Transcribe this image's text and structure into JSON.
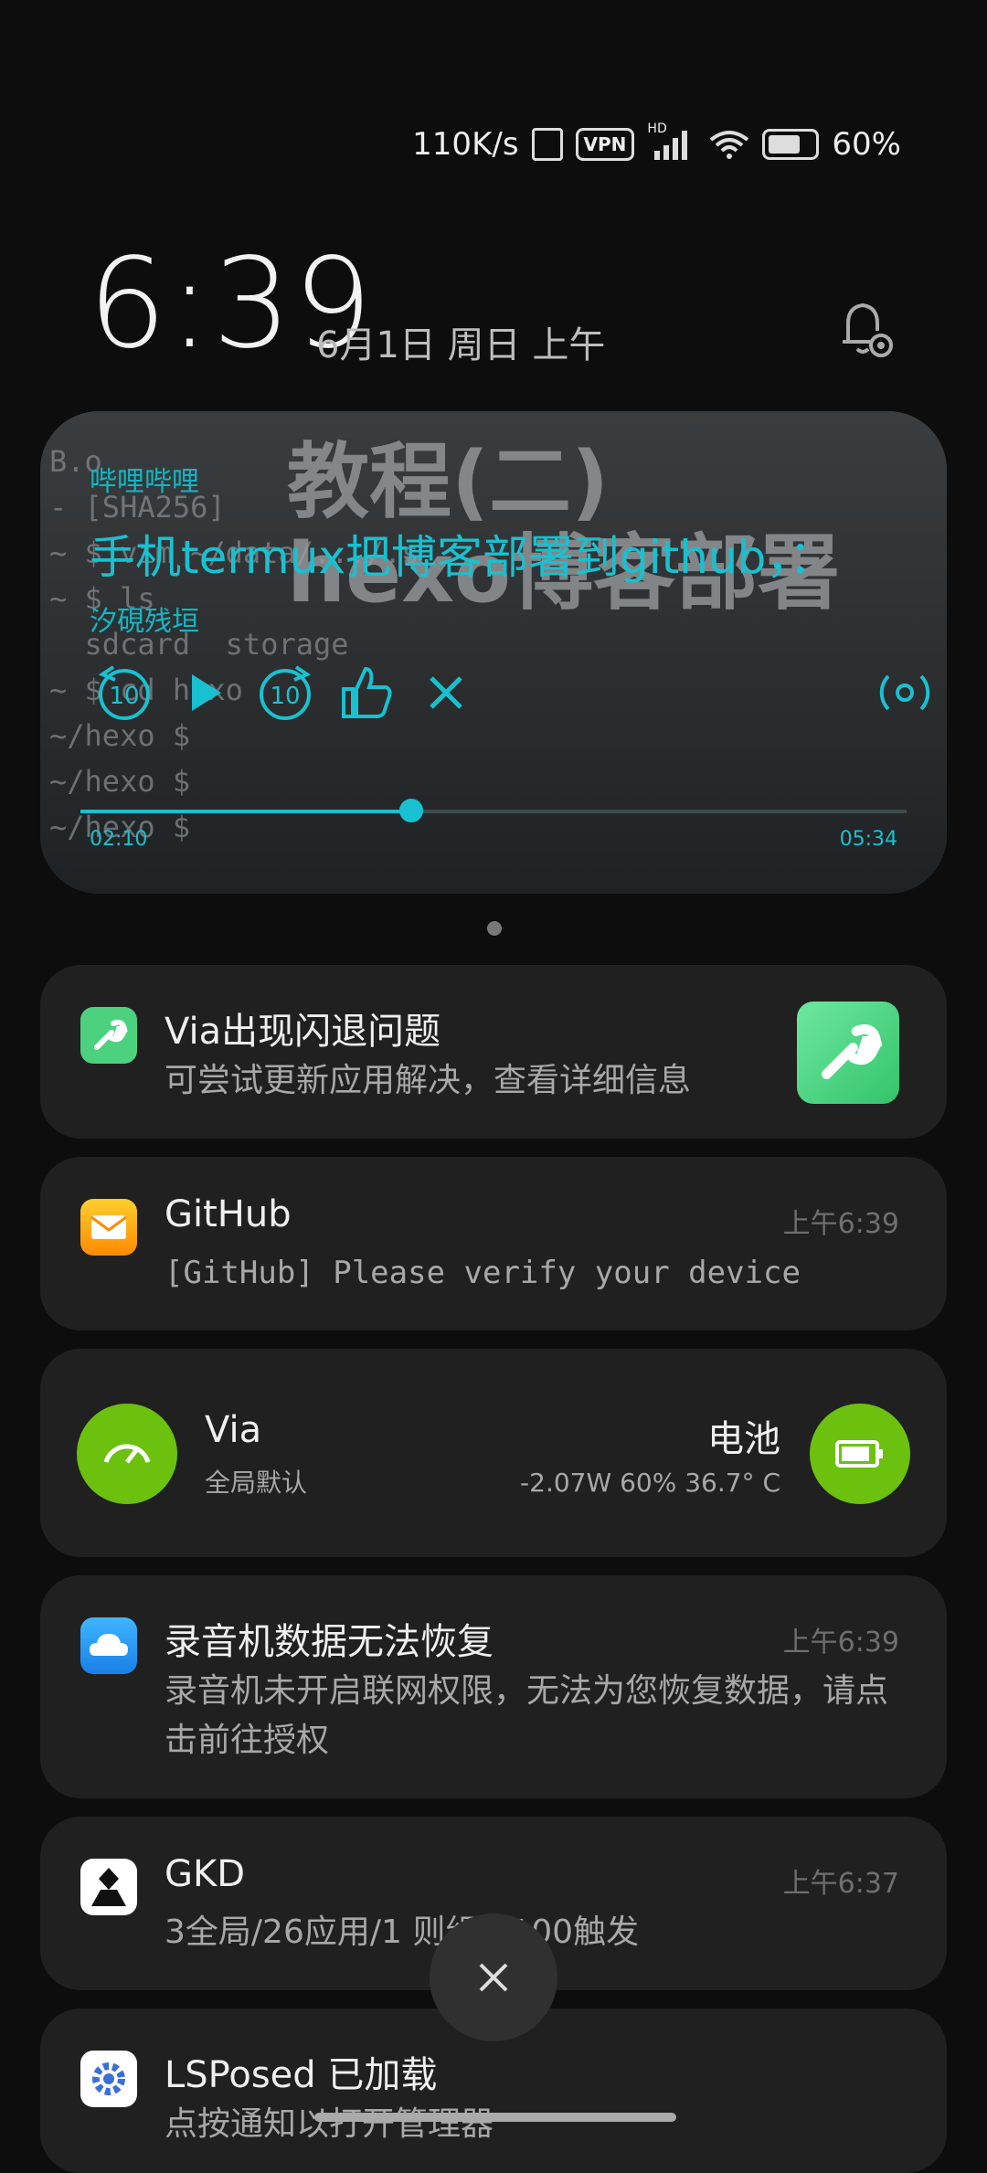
{
  "status_bar": {
    "speed": "110K/s",
    "vpn": "VPN",
    "hd": "HD",
    "battery": "60%",
    "icons": [
      "nfc-icon",
      "vpn-icon",
      "signal-icon",
      "wifi-icon",
      "battery-icon"
    ]
  },
  "lock": {
    "time": "6:39",
    "date": "6月1日 周日 上午"
  },
  "media": {
    "app": "哔哩哔哩",
    "title": "手机termux把博客部署到github，：",
    "artist": "汐硯残垣",
    "bg_big_text": "教程(二)\nhexo博客部署",
    "bg_terminal": "B.o\n- [SHA256]\n~ $ vim ~/data/.../.s\n~ $ ls\n  sdcard  storage\n~ $ cd hexo\n~/hexo $\n~/hexo $\n~/hexo $",
    "elapsed": "02:10",
    "duration": "05:34",
    "progress": 0.4,
    "accent": "#18c1d0"
  },
  "notifications": [
    {
      "title": "Via出现闪退问题",
      "body": "可尝试更新应用解决，查看详细信息",
      "icon": "wrench-icon"
    },
    {
      "title": "GitHub",
      "body": "[GitHub] Please verify your device",
      "time": "上午6:39",
      "icon": "mail-icon"
    },
    {
      "left_title": "Via",
      "left_sub": "全局默认",
      "right_title": "电池",
      "right_sub": "-2.07W 60% 36.7° C"
    },
    {
      "title": "录音机数据无法恢复",
      "body": "录音机未开启联网权限，无法为您恢复数据，请点击前往授权",
      "time": "上午6:39",
      "icon": "cloud-icon"
    },
    {
      "title": "GKD",
      "body": "3全局/26应用/1 则组/1100触发",
      "time": "上午6:37",
      "icon": "gkd-icon"
    },
    {
      "title": "LSPosed 已加载",
      "body": "点按通知以打开管理器",
      "icon": "gear-icon"
    }
  ],
  "clear_button": "clear-all"
}
